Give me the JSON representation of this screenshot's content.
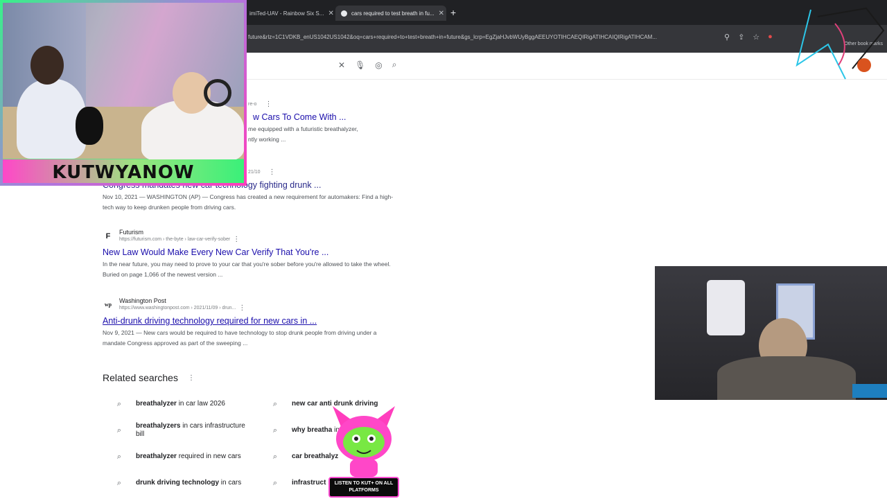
{
  "browser": {
    "tabs": [
      {
        "label": "imiTed-UAV - Rainbow Six S..."
      },
      {
        "label": "cars required to test breath in fu..."
      }
    ],
    "url": "future&rlz=1C1VDKB_enUS1042US1042&oq=cars+required+to+test+breath+in+future&gs_lcrp=EgZjaHJvbWUyBggAEEUYOTIHCAEQIRigATIHCAIQIRigATIHCAM...",
    "other_bookmarks": "Other book marks"
  },
  "results": [
    {
      "source_url": "re-o",
      "title": "w Cars To Come With ...",
      "snippet": "me equipped with a futuristic breathalyzer,\nntly working ..."
    },
    {
      "source_url": "21/10",
      "title": "Congress mandates new car technology fighting drunk ...",
      "snippet_date": "Nov 10, 2021",
      "snippet": " — WASHINGTON (AP) — Congress has created a new requirement for automakers: Find a high-tech way to keep drunken people from driving cars."
    },
    {
      "source_name": "Futurism",
      "favicon": "F",
      "source_url": "https://futurism.com › the-byte › law-car-verify-sober",
      "title": "New Law Would Make Every New Car Verify That You're ...",
      "snippet": "In the near future, you may need to prove to your car that you're sober before you're allowed to take the wheel. Buried on page 1,066 of the newest version ..."
    },
    {
      "source_name": "Washington Post",
      "favicon": "wp",
      "source_url": "https://www.washingtonpost.com › 2021/11/09 › drun...",
      "title": "Anti-drunk driving technology required for new cars in ...",
      "snippet_date": "Nov 9, 2021",
      "snippet": " — New cars would be required to have technology to stop drunk people from driving under a mandate Congress approved as part of the sweeping ..."
    }
  ],
  "related": {
    "heading": "Related searches",
    "items": [
      {
        "bold": "breathalyzer",
        "rest": " in car law 2026"
      },
      {
        "bold": "new car anti drunk driving",
        "rest": ""
      },
      {
        "bold": "breathalyzers",
        "rest": " in cars infrastructure bill"
      },
      {
        "bold": "why breatha",
        "rest": " installed in ca"
      },
      {
        "bold": "breathalyzer",
        "rest": " required in new cars"
      },
      {
        "bold": "car breathalyz",
        "rest": ""
      },
      {
        "bold": "drunk driving technology",
        "rest": " in cars"
      },
      {
        "bold": "infrastruct",
        "rest": " monitoring"
      }
    ]
  },
  "overlays": {
    "streamer_name": "KUTWYANOW",
    "mascot_badge": "LISTEN TO KUT+ ON ALL PLATFORMS"
  }
}
